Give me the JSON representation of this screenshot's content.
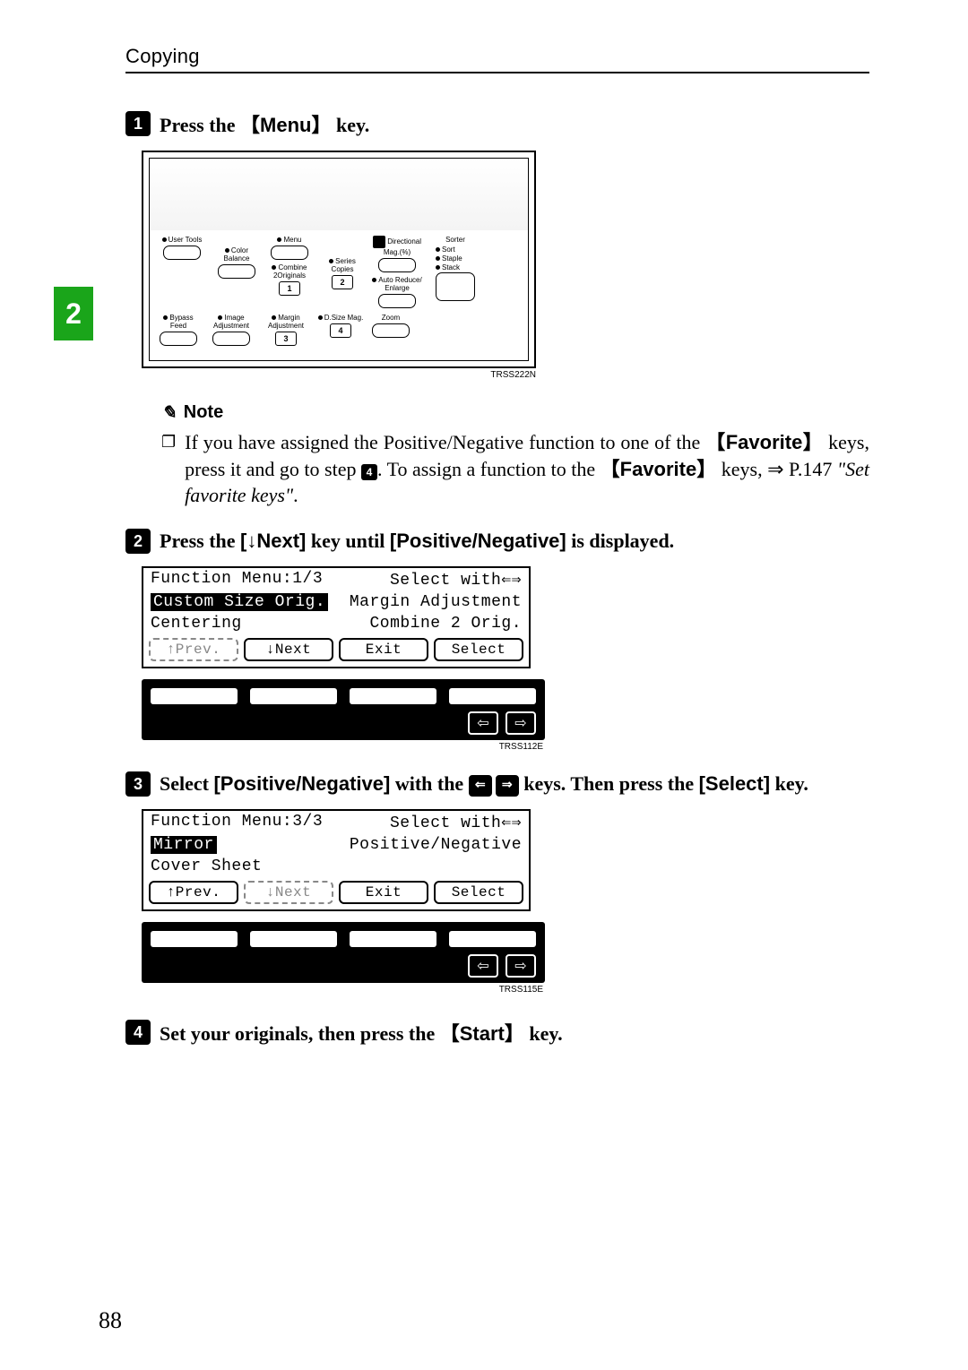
{
  "header": {
    "section": "Copying"
  },
  "side_tab": "2",
  "steps": {
    "s1": {
      "num": "1",
      "text_before": "Press the ",
      "key": "Menu",
      "text_after": " key.",
      "panel": {
        "user_tools": "User Tools",
        "menu": "Menu",
        "directional_mag": "Directional\nMag.(%)",
        "sorter": "Sorter",
        "sort": "Sort",
        "staple": "Staple",
        "stack": "Stack",
        "color_balance": "Color\nBalance",
        "combine": "Combine\n2Originals",
        "series_copies": "Series\nCopies",
        "auto_reduce_enlarge": "Auto Reduce/\nEnlarge",
        "bypass_feed": "Bypass\nFeed",
        "image_adjust": "Image\nAdjustment",
        "margin_adjust": "Margin\nAdjustment",
        "dsize_mag": "D.Size Mag.",
        "zoom": "Zoom",
        "n1": "1",
        "n2": "2",
        "n3": "3",
        "n4": "4"
      },
      "code": "TRSS222N"
    },
    "note": {
      "heading": "Note",
      "text": "If you have assigned the Positive/Negative function to one of the 【Favorite】 keys, press it and go to step ",
      "step_ref": "4",
      "text2": ". To assign a function to the 【Favorite】 keys, ⇒ P.147 ",
      "ital": "\"Set favorite keys\"",
      "text3": "."
    },
    "s2": {
      "num": "2",
      "text": "Press the [↓Next] key until [Positive/Negative] is displayed.",
      "lcd": {
        "title_l": "Function Menu:1/3",
        "title_r": "Select with",
        "r1a": "Custom Size Orig.",
        "r1b": "Margin Adjustment",
        "r2a": "Centering",
        "r2b": "Combine 2 Orig.",
        "b_prev": "↑Prev.",
        "b_next": "↓Next",
        "b_exit": "Exit",
        "b_select": "Select"
      },
      "code": "TRSS112E"
    },
    "s3": {
      "num": "3",
      "text_before": "Select [Positive/Negative] with the ",
      "text_after": " keys. Then press the [Select] key.",
      "lcd": {
        "title_l": "Function Menu:3/3",
        "title_r": "Select with",
        "r1a": "Mirror",
        "r1b": "Positive/Negative",
        "r2a": "Cover Sheet",
        "r2b": "",
        "b_prev": "↑Prev.",
        "b_next": "↓Next",
        "b_exit": "Exit",
        "b_select": "Select"
      },
      "code": "TRSS115E"
    },
    "s4": {
      "num": "4",
      "text_before": "Set your originals, then press the ",
      "key": "Start",
      "text_after": " key."
    }
  },
  "page_number": "88"
}
